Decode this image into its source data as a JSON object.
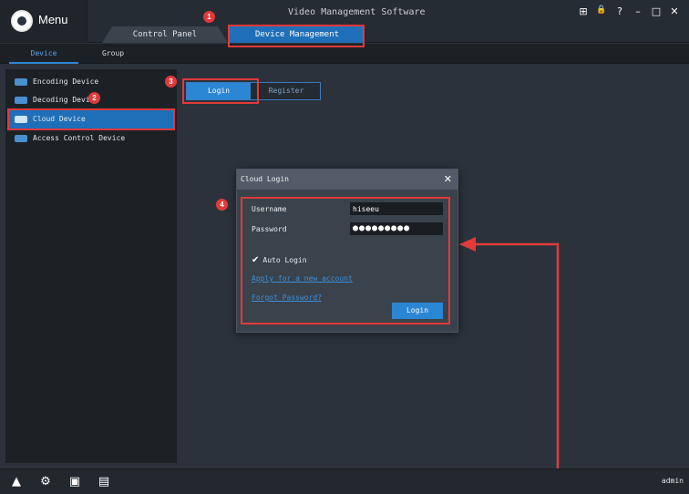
{
  "app": {
    "menu_label": "Menu",
    "title": "Video Management Software"
  },
  "tabs": {
    "control_panel": "Control Panel",
    "device_management": "Device Management"
  },
  "window_controls": {
    "group": "⊞",
    "lock": "🔒",
    "help": "?",
    "minimize": "–",
    "maximize": "□",
    "close": "✕"
  },
  "subnav": {
    "device": "Device",
    "group": "Group"
  },
  "sidebar": {
    "items": [
      {
        "label": "Encoding Device",
        "icon": "device-icon"
      },
      {
        "label": "Decoding Device",
        "icon": "device-icon"
      },
      {
        "label": "Cloud Device",
        "icon": "cloud-device-icon"
      },
      {
        "label": "Access Control Device",
        "icon": "device-icon"
      }
    ]
  },
  "main": {
    "login_tab": "Login",
    "register_tab": "Register"
  },
  "dialog": {
    "title": "Cloud Login",
    "close": "✕",
    "username_label": "Username",
    "username_value": "hiseeu",
    "password_label": "Password",
    "password_value": "●●●●●●●●●",
    "auto_login_label": "Auto Login",
    "check": "✔",
    "apply_link": "Apply for a new account",
    "forgot_link": "Forgot Password?",
    "login_button": "Login"
  },
  "badges": {
    "b1": "1",
    "b2": "2",
    "b3": "3",
    "b4": "4"
  },
  "bottombar": {
    "icons": [
      "warning-icon",
      "settings-badge-icon",
      "monitor-icon",
      "document-icon"
    ],
    "user": "admin"
  },
  "colors": {
    "accent": "#2b86d4",
    "highlight": "#e23a3a",
    "background": "#2b323b"
  }
}
